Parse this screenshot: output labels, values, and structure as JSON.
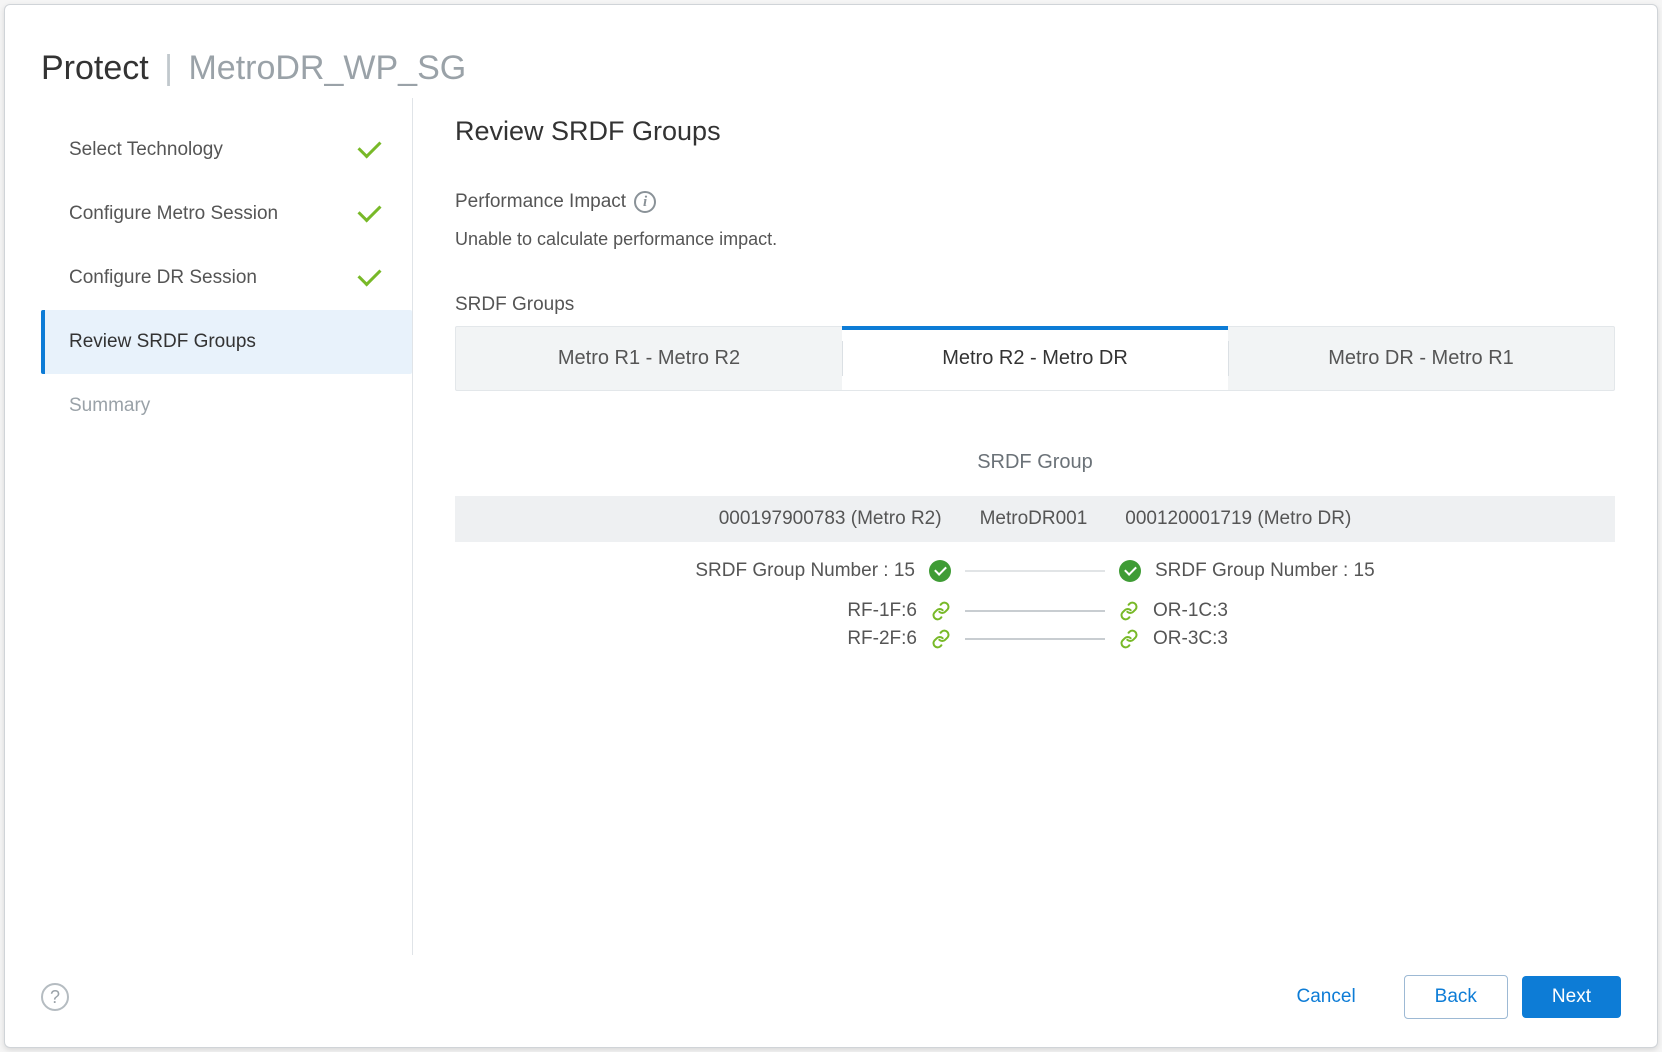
{
  "header": {
    "title": "Protect",
    "subtitle": "MetroDR_WP_SG"
  },
  "sidebar": {
    "steps": [
      {
        "label": "Select Technology",
        "state": "done"
      },
      {
        "label": "Configure Metro Session",
        "state": "done"
      },
      {
        "label": "Configure DR Session",
        "state": "done"
      },
      {
        "label": "Review SRDF Groups",
        "state": "active"
      },
      {
        "label": "Summary",
        "state": "pending"
      }
    ]
  },
  "main": {
    "heading": "Review SRDF Groups",
    "perf_label": "Performance Impact",
    "perf_message": "Unable to calculate performance impact.",
    "srdf_section_label": "SRDF Groups",
    "tabs": [
      {
        "label": "Metro R1 - Metro R2",
        "active": false
      },
      {
        "label": "Metro R2 - Metro DR",
        "active": true
      },
      {
        "label": "Metro DR - Metro R1",
        "active": false
      }
    ],
    "srdf_group_title": "SRDF Group",
    "pair_header": {
      "left": "000197900783 (Metro R2)",
      "middle": "MetroDR001",
      "right": "000120001719 (Metro DR)"
    },
    "group_number": {
      "left_label": "SRDF Group Number : 15",
      "right_label": "SRDF Group Number : 15"
    },
    "port_pairs": [
      {
        "left": "RF-1F:6",
        "right": "OR-1C:3"
      },
      {
        "left": "RF-2F:6",
        "right": "OR-3C:3"
      }
    ]
  },
  "footer": {
    "cancel": "Cancel",
    "back": "Back",
    "next": "Next"
  }
}
